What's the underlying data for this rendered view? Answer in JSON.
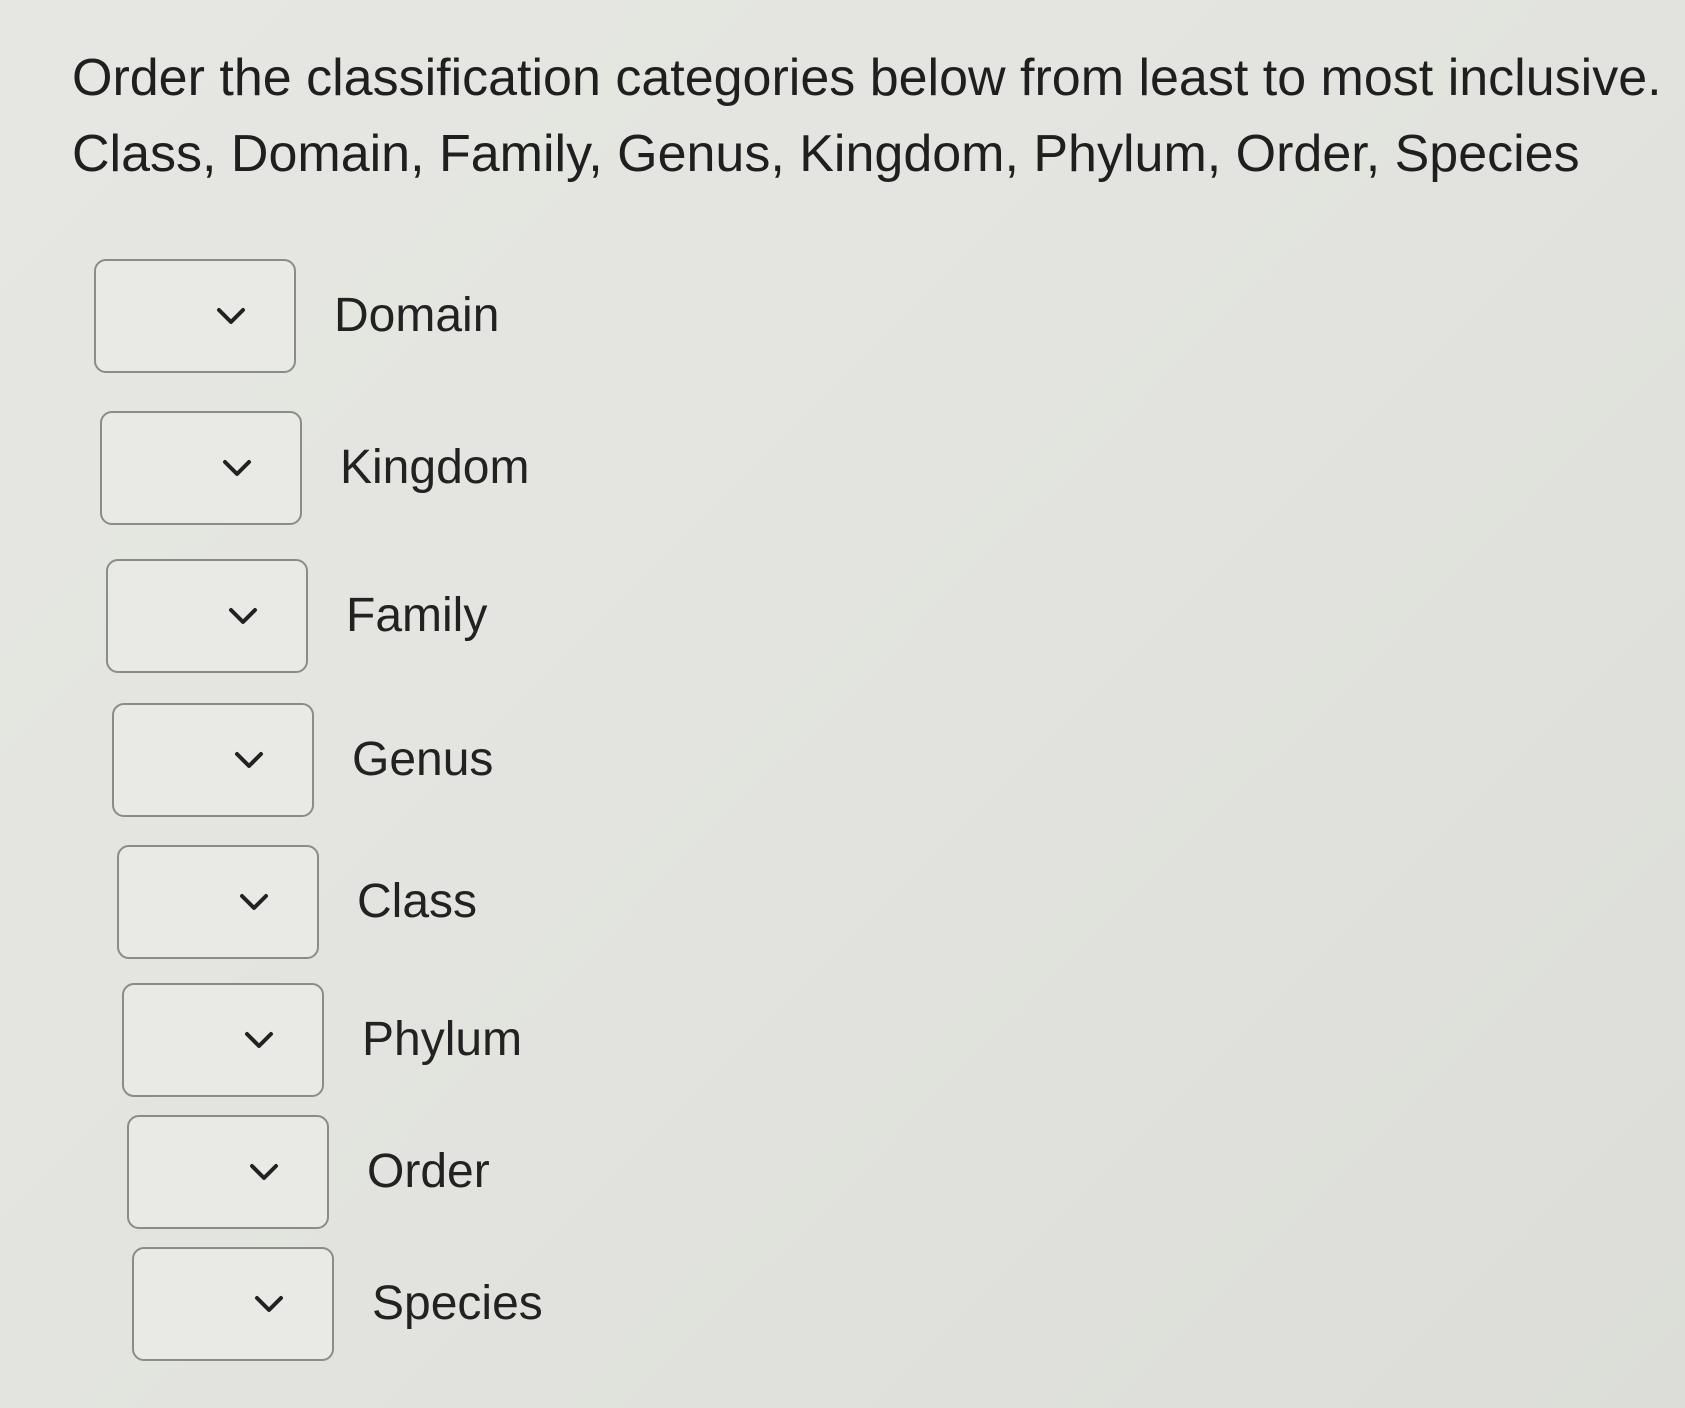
{
  "question": {
    "prompt": "Order the classification categories below from least to most inclusive.",
    "options_line": "Class, Domain, Family, Genus, Kingdom, Phylum, Order, Species"
  },
  "rows": [
    {
      "selected": "",
      "label": "Domain"
    },
    {
      "selected": "",
      "label": "Kingdom"
    },
    {
      "selected": "",
      "label": "Family"
    },
    {
      "selected": "",
      "label": "Genus"
    },
    {
      "selected": "",
      "label": "Class"
    },
    {
      "selected": "",
      "label": "Phylum"
    },
    {
      "selected": "",
      "label": "Order"
    },
    {
      "selected": "",
      "label": "Species"
    }
  ],
  "icons": {
    "dropdown": "chevron-down-icon"
  },
  "colors": {
    "background": "#e4e5e0",
    "box_border": "#8a8c88",
    "text": "#1f1f1f"
  }
}
